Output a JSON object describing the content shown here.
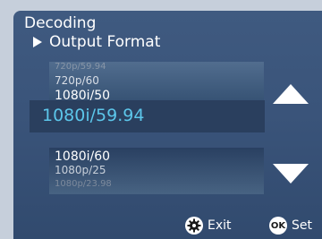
{
  "header": {
    "title": "Decoding",
    "subtitle": "Output Format"
  },
  "format_list": {
    "items_above": [
      "720p/59.94",
      "720p/60",
      "1080i/50"
    ],
    "selected": "1080i/59.94",
    "items_below": [
      "1080i/60",
      "1080p/25",
      "1080p/23.98"
    ]
  },
  "footer": {
    "exit_label": "Exit",
    "set_label": "Set",
    "ok_badge": "OK"
  },
  "colors": {
    "panel": "#3a547a",
    "selected_text": "#5cc6ea",
    "background": "#c6cfdb"
  },
  "icons": {
    "subtitle": "triangle-right-icon",
    "scroll_up": "triangle-up-icon",
    "scroll_down": "triangle-down-icon",
    "exit": "gear-icon",
    "set": "ok-circle-icon"
  }
}
